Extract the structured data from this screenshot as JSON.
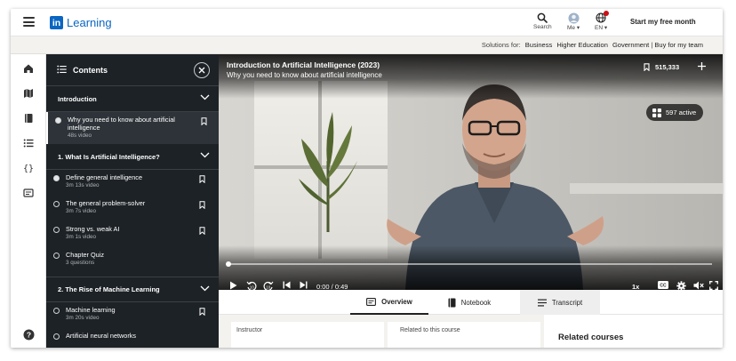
{
  "nav": {
    "logo_in": "in",
    "logo_word": "Learning",
    "search_label": "Search",
    "me_label": "Me",
    "lang_label": "EN",
    "cta": "Start my free month"
  },
  "solutions": {
    "prefix": "Solutions for:",
    "links": [
      "Business",
      "Higher Education",
      "Government",
      "Buy for my team"
    ]
  },
  "contents": {
    "title": "Contents",
    "sections": [
      {
        "title": "Introduction",
        "items": [
          {
            "title": "Why you need to know about artificial intelligence",
            "meta": "48s video",
            "status": "in-progress"
          }
        ]
      },
      {
        "title": "1. What Is Artificial Intelligence?",
        "items": [
          {
            "title": "Define general intelligence",
            "meta": "3m 13s video",
            "status": "in-progress"
          },
          {
            "title": "The general problem-solver",
            "meta": "3m 7s video",
            "status": "not-started"
          },
          {
            "title": "Strong vs. weak AI",
            "meta": "3m 1s video",
            "status": "not-started"
          },
          {
            "title": "Chapter Quiz",
            "meta": "3 questions",
            "status": "not-started"
          }
        ]
      },
      {
        "title": "2. The Rise of Machine Learning",
        "items": [
          {
            "title": "Machine learning",
            "meta": "3m 20s video",
            "status": "not-started"
          },
          {
            "title": "Artificial neural networks",
            "meta": "",
            "status": "not-started"
          }
        ]
      }
    ]
  },
  "video": {
    "course_title": "Introduction to Artificial Intelligence (2023)",
    "video_title": "Why you need to know about artificial intelligence",
    "saves": "515,333",
    "active": "597 active",
    "time": "0:00 / 0:49",
    "speed": "1x",
    "progress": 0.0
  },
  "tabs": [
    {
      "label": "Overview",
      "icon": "overview-icon"
    },
    {
      "label": "Notebook",
      "icon": "notebook-icon"
    },
    {
      "label": "Transcript",
      "icon": "transcript-icon"
    }
  ],
  "details": {
    "instructor_label": "Instructor",
    "related_label": "Related to this course",
    "related_courses": "Related courses"
  }
}
